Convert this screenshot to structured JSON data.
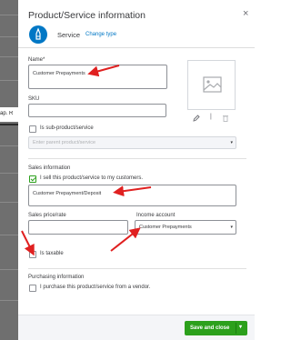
{
  "background": {
    "text": "ap. R"
  },
  "panel": {
    "title": "Product/Service information",
    "close_glyph": "×",
    "type": {
      "icon": "service-icon",
      "label": "Service",
      "change_link": "Change type"
    }
  },
  "form": {
    "name": {
      "label": "Name*",
      "value": "Customer Prepayments"
    },
    "sku": {
      "label": "SKU",
      "value": ""
    },
    "sub_product": {
      "label": "Is sub-product/service",
      "checked": false,
      "placeholder": "Enter parent product/service"
    },
    "sales": {
      "heading": "Sales information",
      "sell_checkbox_label": "I sell this product/service to my customers.",
      "sell_checked": true,
      "description": "Customer Prepayment/Deposit",
      "price_label": "Sales price/rate",
      "price_value": "",
      "income_label": "Income account",
      "income_value": "Customer Prepayments",
      "taxable_label": "Is taxable",
      "taxable_checked": false
    },
    "purchasing": {
      "heading": "Purchasing information",
      "purchase_checkbox_label": "I purchase this product/service from a vendor.",
      "purchase_checked": false
    }
  },
  "image_actions": {
    "edit_icon": "pencil-icon",
    "separator": "|",
    "delete_icon": "trash-icon"
  },
  "footer": {
    "save_label": "Save and close",
    "dropdown_glyph": "▾"
  },
  "colors": {
    "accent": "#0077c5",
    "save_green": "#2ca01c",
    "annotation_red": "#e02020"
  }
}
